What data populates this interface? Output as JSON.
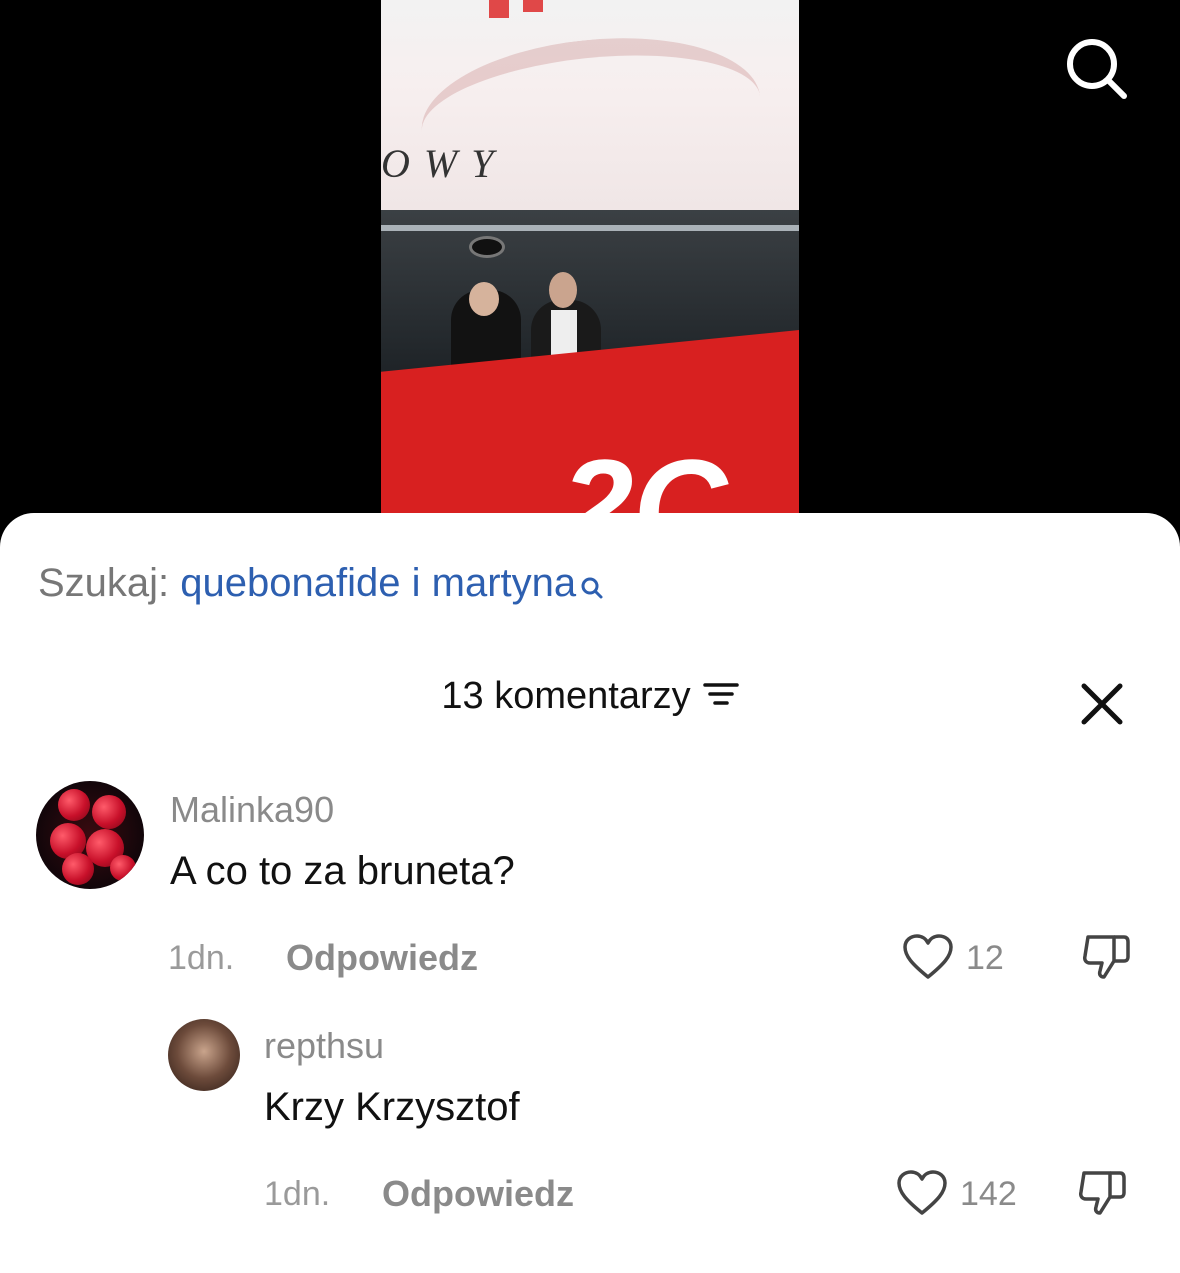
{
  "video": {
    "banner_text": "OWY"
  },
  "search": {
    "label": "Szukaj:",
    "query": "quebonafide i martyna"
  },
  "comments_header": {
    "count_label": "13 komentarzy"
  },
  "comments": [
    {
      "username": "Malinka90",
      "text": "A co to za bruneta?",
      "time": "1dn.",
      "reply_label": "Odpowiedz",
      "likes": "12"
    },
    {
      "username": "repthsu",
      "text": "Krzy Krzysztof",
      "time": "1dn.",
      "reply_label": "Odpowiedz",
      "likes": "142"
    }
  ],
  "colors": {
    "search_query": "#2d5fb0",
    "muted_text": "#8a8a8a",
    "sheet_bg": "#ffffff"
  }
}
